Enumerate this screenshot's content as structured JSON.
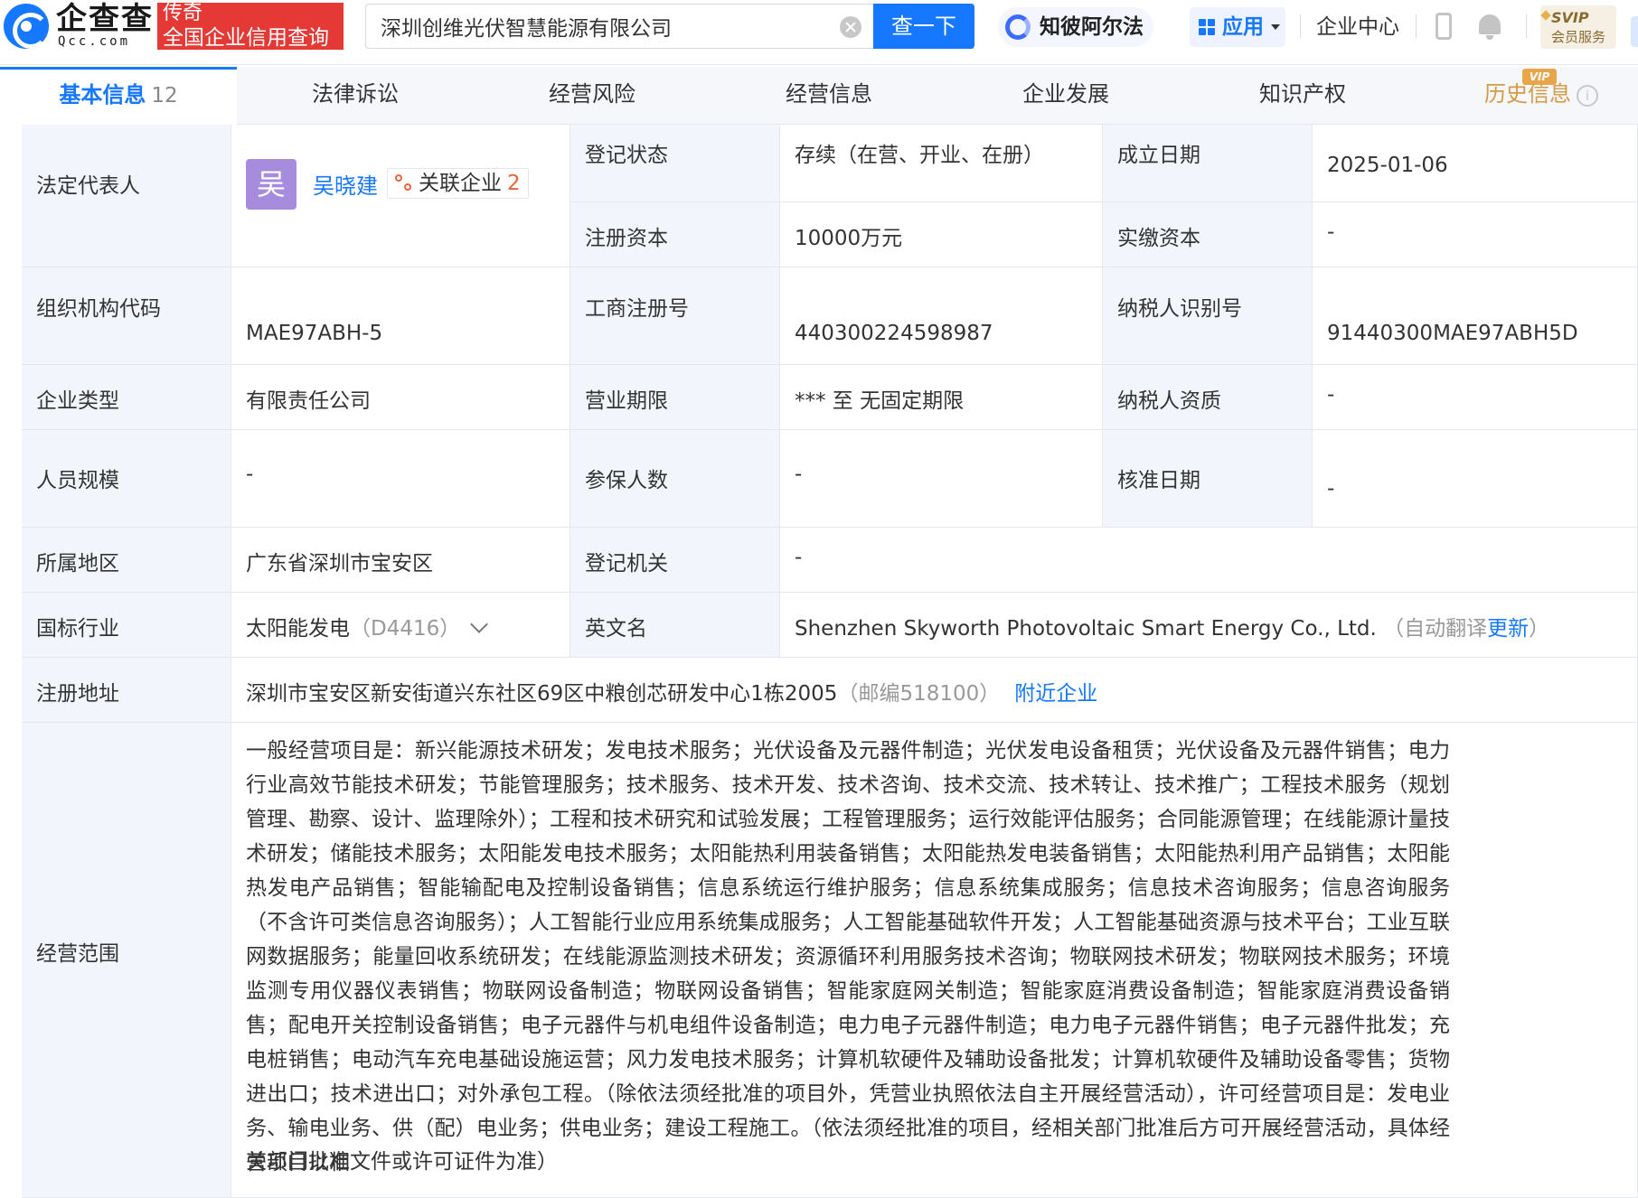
{
  "header": {
    "logo_text": "企查查",
    "logo_sub": "Qcc.com",
    "badge_line1": "传奇",
    "badge_line2": "全国企业信用查询",
    "search_value": "深圳创维光伏智慧能源有限公司",
    "search_button": "查一下",
    "zhibi_label": "知彼阿尔法",
    "apps_label": "应用",
    "center_label": "企业中心",
    "svip_line1": "SVIP",
    "svip_line2": "会员服务"
  },
  "tabs": [
    {
      "label": "基本信息",
      "count": "12"
    },
    {
      "label": "法律诉讼"
    },
    {
      "label": "经营风险"
    },
    {
      "label": "经营信息"
    },
    {
      "label": "企业发展"
    },
    {
      "label": "知识产权"
    },
    {
      "label": "历史信息",
      "badge": "VIP"
    }
  ],
  "info": {
    "legal_rep_label": "法定代表人",
    "avatar_char": "吴",
    "legal_rep_name": "吴晓建",
    "related_label": "关联企业",
    "related_count": "2",
    "reg_status_label": "登记状态",
    "reg_status": "存续（在营、开业、在册）",
    "found_date_label": "成立日期",
    "found_date": "2025-01-06",
    "reg_capital_label": "注册资本",
    "reg_capital": "10000万元",
    "paid_capital_label": "实缴资本",
    "paid_capital": "-",
    "org_code_label": "组织机构代码",
    "org_code": "MAE97ABH-5",
    "biz_reg_no_label": "工商注册号",
    "biz_reg_no": "440300224598987",
    "taxpayer_id_label": "纳税人识别号",
    "taxpayer_id": "91440300MAE97ABH5D",
    "company_type_label": "企业类型",
    "company_type": "有限责任公司",
    "biz_term_label": "营业期限",
    "biz_term": "*** 至 无固定期限",
    "taxpayer_qual_label": "纳税人资质",
    "taxpayer_qual": "-",
    "staff_size_label": "人员规模",
    "staff_size": "-",
    "insured_label": "参保人数",
    "insured": "-",
    "approve_date_label": "核准日期",
    "approve_date": "-",
    "region_label": "所属地区",
    "region": "广东省深圳市宝安区",
    "reg_authority_label": "登记机关",
    "reg_authority": "-",
    "industry_label": "国标行业",
    "industry": "太阳能发电",
    "industry_code": "（D4416）",
    "english_name_label": "英文名",
    "english_name": "Shenzhen Skyworth Photovoltaic Smart Energy Co., Ltd.",
    "auto_translate": "（自动翻译",
    "update_link": "更新",
    "close_paren": "）",
    "address_label": "注册地址",
    "address": "深圳市宝安区新安街道兴东社区69区中粮创芯研发中心1栋2005",
    "postcode": "（邮编518100）",
    "nearby_link": "附近企业",
    "scope_label": "经营范围",
    "scope_text": "一般经营项目是：新兴能源技术研发；发电技术服务；光伏设备及元器件制造；光伏发电设备租赁；光伏设备及元器件销售；电力行业高效节能技术研发；节能管理服务；技术服务、技术开发、技术咨询、技术交流、技术转让、技术推广；工程技术服务（规划管理、勘察、设计、监理除外）；工程和技术研究和试验发展；工程管理服务；运行效能评估服务；合同能源管理；在线能源计量技术研发；储能技术服务；太阳能发电技术服务；太阳能热利用装备销售；太阳能热发电装备销售；太阳能热利用产品销售；太阳能热发电产品销售；智能输配电及控制设备销售；信息系统运行维护服务；信息系统集成服务；信息技术咨询服务；信息咨询服务（不含许可类信息咨询服务）；人工智能行业应用系统集成服务；人工智能基础软件开发；人工智能基础资源与技术平台；工业互联网数据服务；能量回收系统研发；在线能源监测技术研发；资源循环利用服务技术咨询；物联网技术研发；物联网技术服务；环境监测专用仪器仪表销售；物联网设备制造；物联网设备销售；智能家庭网关制造；智能家庭消费设备制造；智能家庭消费设备销售；配电开关控制设备销售；电子元器件与机电组件设备制造；电力电子元器件制造；电力电子元器件销售；电子元器件批发；充电桩销售；电动汽车充电基础设施运营；风力发电技术服务；计算机软硬件及辅助设备批发；计算机软硬件及辅助设备零售；货物进出口；技术进出口；对外承包工程。（除依法须经批准的项目外，凭营业执照依法自主开展经营活动），许可经营项目是：发电业务、输电业务、供（配）电业务；供电业务；建设工程施工。（依法须经批准的项目，经相关部门批准后方可开展经营活动，具体经营项目以相",
    "scope_tail": "关部门批准文件或许可证件为准）"
  }
}
